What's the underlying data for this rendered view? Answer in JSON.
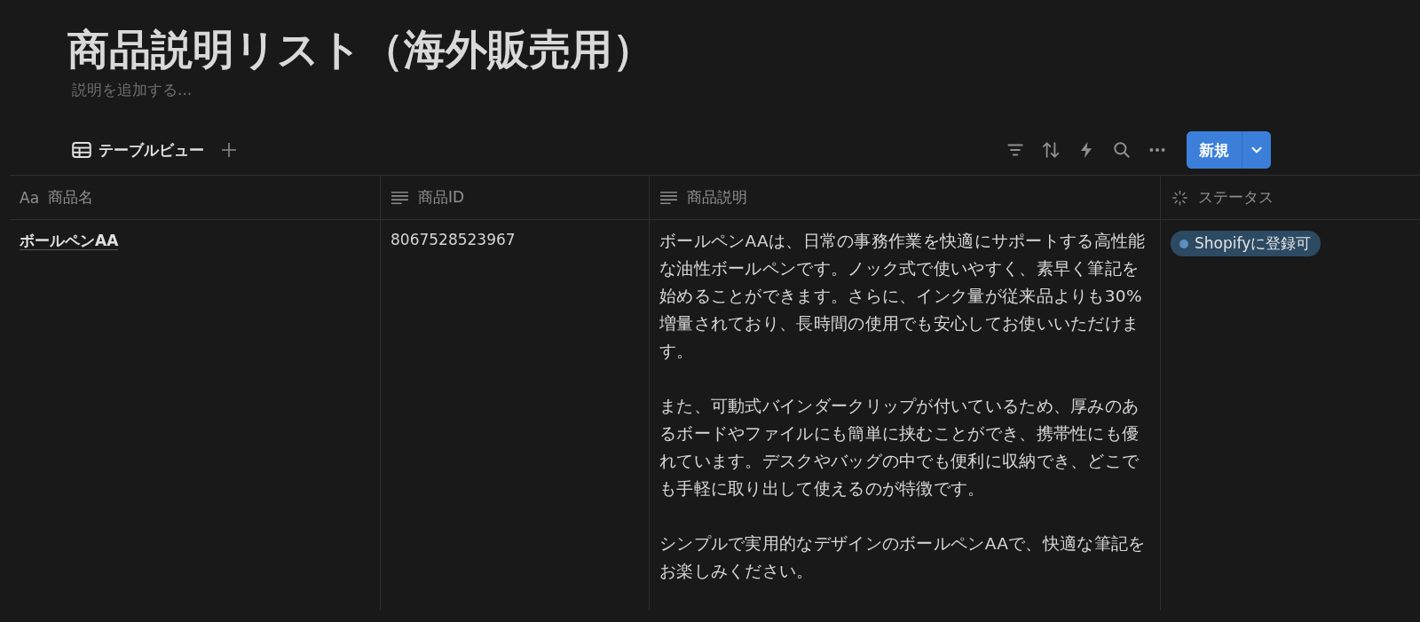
{
  "title": "商品説明リスト（海外販売用）",
  "description": {
    "placeholder": "説明を追加する..."
  },
  "views": [
    {
      "label": "テーブルビュー",
      "selected": true
    }
  ],
  "toolbar": {
    "new_button": "新規"
  },
  "table": {
    "columns": [
      {
        "kind": "title",
        "icon_text": "Aa",
        "label": "商品名"
      },
      {
        "kind": "text",
        "label": "商品ID"
      },
      {
        "kind": "text",
        "label": "商品説明"
      },
      {
        "kind": "status",
        "label": "ステータス"
      }
    ],
    "rows": [
      {
        "name": "ボールペンAA",
        "id": "8067528523967",
        "description": [
          "ボールペンAAは、日常の事務作業を快適にサポートする高性能な油性ボールペンです。ノック式で使いやすく、素早く筆記を始めることができます。さらに、インク量が従来品よりも30%増量されており、長時間の使用でも安心してお使いいただけます。",
          "また、可動式バインダークリップが付いているため、厚みのあるボードやファイルにも簡単に挟むことができ、携帯性にも優れています。デスクやバッグの中でも便利に収納でき、どこでも手軽に取り出して使えるのが特徴です。",
          "シンプルで実用的なデザインのボールペンAAで、快適な筆記をお楽しみください。"
        ],
        "status": {
          "label": "Shopifyに登録可",
          "color": "#5b8fc0"
        }
      }
    ]
  }
}
